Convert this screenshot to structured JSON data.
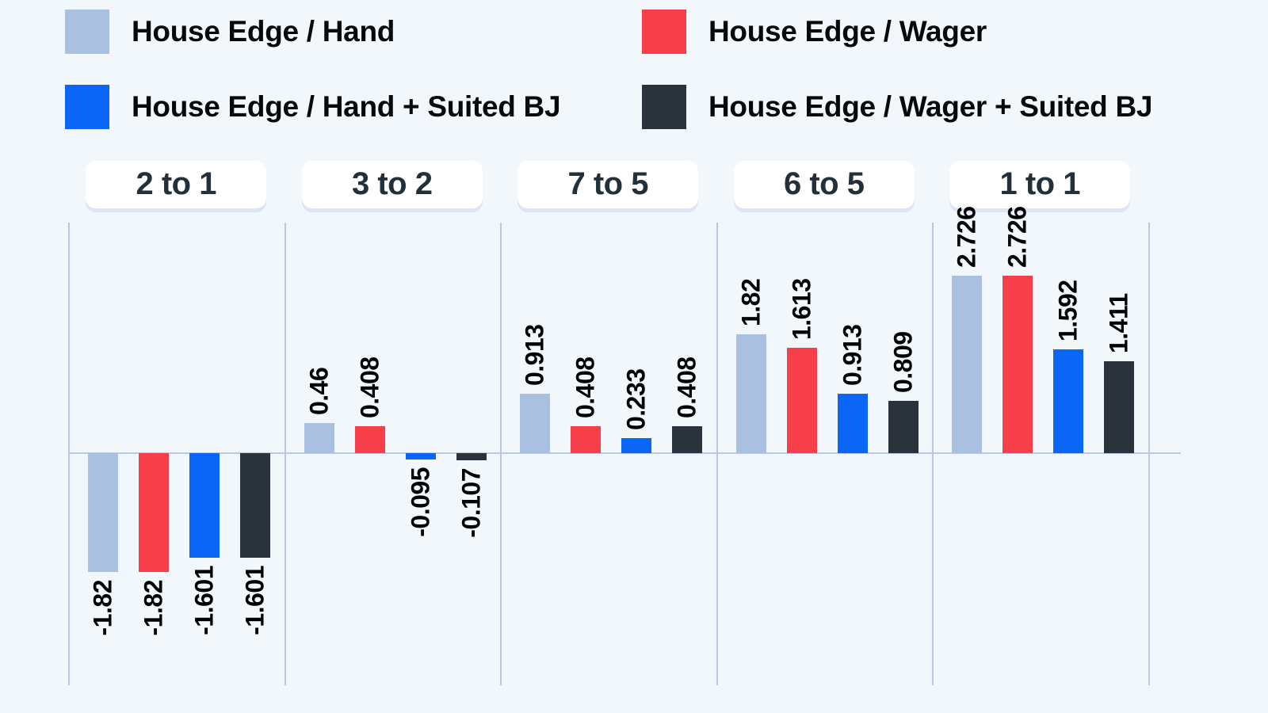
{
  "legend": {
    "items": [
      {
        "label": "House Edge / Hand",
        "color": "#aac0e0",
        "icon": "legend-swatch-icon"
      },
      {
        "label": "House Edge / Wager",
        "color": "#f73f49",
        "icon": "legend-swatch-icon"
      },
      {
        "label": "House Edge / Hand + Suited BJ",
        "color": "#0b66f5",
        "icon": "legend-swatch-icon"
      },
      {
        "label": "House Edge / Wager + Suited BJ",
        "color": "#2a333c",
        "icon": "legend-swatch-icon"
      }
    ]
  },
  "colors": {
    "background": "#f2f7fc",
    "axis_line": "#b7c9e6",
    "group_card": "#ffffff",
    "group_card_shadow": "#dbe6f5",
    "label_text": "#22303b",
    "value_text": "#000000"
  },
  "chart_data": {
    "type": "bar",
    "title": "",
    "xlabel": "",
    "ylabel": "",
    "grid": false,
    "legend_position": "top",
    "categories": [
      "2 to 1",
      "3 to 2",
      "7 to 5",
      "6 to 5",
      "1 to 1"
    ],
    "series": [
      {
        "name": "House Edge / Hand",
        "color": "#aac0e0",
        "values": [
          -1.82,
          0.46,
          0.913,
          1.82,
          2.726
        ],
        "labels": [
          "-1.82",
          "0.46",
          "0.913",
          "1.82",
          "2.726"
        ]
      },
      {
        "name": "House Edge / Wager",
        "color": "#f73f49",
        "values": [
          -1.82,
          0.408,
          0.408,
          1.613,
          2.726
        ],
        "labels": [
          "-1.82",
          "0.408",
          "0.408",
          "1.613",
          "2.726"
        ]
      },
      {
        "name": "House Edge / Hand + Suited BJ",
        "color": "#0b66f5",
        "values": [
          -1.601,
          -0.095,
          0.233,
          0.913,
          1.592
        ],
        "labels": [
          "-1.601",
          "-0.095",
          "0.233",
          "0.913",
          "1.592"
        ]
      },
      {
        "name": "House Edge / Wager + Suited BJ",
        "color": "#2a333c",
        "values": [
          -1.601,
          -0.107,
          0.408,
          0.809,
          1.411
        ],
        "labels": [
          "-1.601",
          "-0.107",
          "0.408",
          "0.809",
          "1.411"
        ]
      }
    ],
    "ylim": [
      -2.4,
      3.4
    ],
    "zero_line": 0
  }
}
